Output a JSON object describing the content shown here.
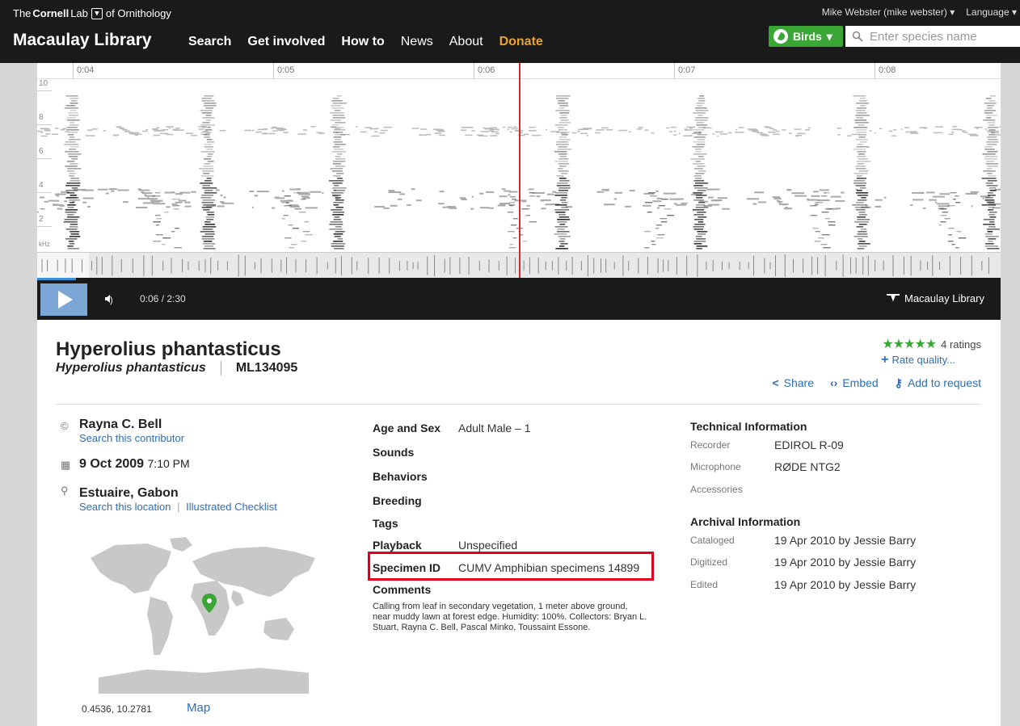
{
  "header": {
    "lab_prefix": "The",
    "lab_name": "Cornell",
    "lab_word": "Lab",
    "lab_suffix": "of Ornithology",
    "site_title": "Macaulay Library",
    "nav": [
      "Search",
      "Get involved",
      "How to",
      "News",
      "About",
      "Donate"
    ],
    "user": "Mike Webster (mike webster)",
    "language": "Language",
    "taxon_button": "Birds",
    "search_placeholder": "Enter species name"
  },
  "player": {
    "time_ticks": [
      "0:04",
      "0:05",
      "0:06",
      "0:07",
      "0:08"
    ],
    "freq_labels": [
      "10",
      "8",
      "6",
      "4",
      "2"
    ],
    "freq_unit": "kHz",
    "time_display": "0:06 / 2:30",
    "brand": "Macaulay Library"
  },
  "asset": {
    "common_name": "Hyperolius phantasticus",
    "scientific_name": "Hyperolius phantasticus",
    "catalog_id": "ML134095",
    "ratings_count": "4 ratings",
    "stars": 5,
    "rate_label": "Rate quality...",
    "actions": [
      "Share",
      "Embed",
      "Add to request"
    ]
  },
  "contributor": {
    "name": "Rayna C. Bell",
    "search_link": "Search this contributor",
    "date": "9 Oct 2009",
    "time": "7:10 PM",
    "location": "Estuaire, Gabon",
    "location_link": "Search this location",
    "checklist_link": "Illustrated Checklist",
    "coords": "0.4536, 10.2781",
    "map_link": "Map"
  },
  "details": [
    {
      "k": "Age and Sex",
      "v": "Adult Male – 1"
    },
    {
      "k": "Sounds",
      "v": ""
    },
    {
      "k": "Behaviors",
      "v": ""
    },
    {
      "k": "Breeding",
      "v": ""
    },
    {
      "k": "Tags",
      "v": ""
    },
    {
      "k": "Playback",
      "v": "Unspecified"
    },
    {
      "k": "Specimen ID",
      "v": "CUMV Amphibian specimens 14899"
    },
    {
      "k": "Comments",
      "v": ""
    }
  ],
  "comments_text": "Calling from leaf in secondary vegetation, 1 meter above ground, near muddy lawn at forest edge. Humidity: 100%. Collectors: Bryan L. Stuart, Rayna C. Bell, Pascal Minko, Toussaint Essone.",
  "technical": {
    "title": "Technical Information",
    "rows": [
      {
        "k": "Recorder",
        "v": "EDIROL R-09"
      },
      {
        "k": "Microphone",
        "v": "RØDE NTG2"
      },
      {
        "k": "Accessories",
        "v": ""
      }
    ]
  },
  "archival": {
    "title": "Archival Information",
    "rows": [
      {
        "k": "Cataloged",
        "v": "19 Apr 2010 by Jessie Barry"
      },
      {
        "k": "Digitized",
        "v": "19 Apr 2010 by Jessie Barry"
      },
      {
        "k": "Edited",
        "v": "19 Apr 2010 by Jessie Barry"
      }
    ]
  },
  "colors": {
    "accent_green": "#3aa635",
    "link_blue": "#2f6db5",
    "donate": "#e8a32b",
    "highlight": "#e0001b"
  }
}
